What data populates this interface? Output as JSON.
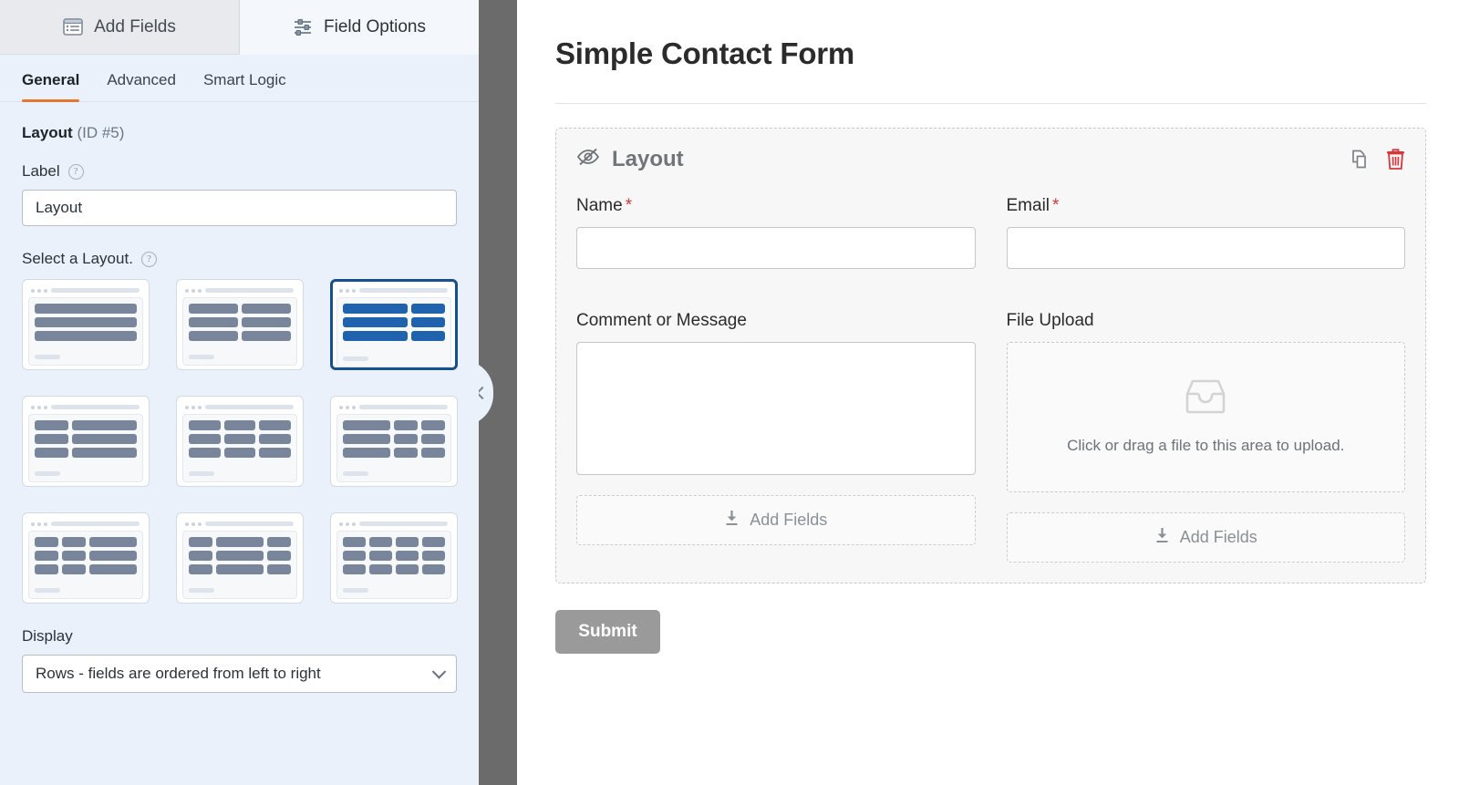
{
  "panel": {
    "tabs": [
      {
        "label": "Add Fields",
        "icon": "form-list-icon",
        "active": false
      },
      {
        "label": "Field Options",
        "icon": "sliders-icon",
        "active": true
      }
    ],
    "subtabs": [
      {
        "label": "General",
        "active": true
      },
      {
        "label": "Advanced",
        "active": false
      },
      {
        "label": "Smart Logic",
        "active": false
      }
    ],
    "field_heading": {
      "name": "Layout",
      "id": "(ID #5)"
    },
    "label_setting": {
      "label": "Label",
      "help_icon": "help-circle-icon",
      "value": "Layout"
    },
    "layout_setting": {
      "label": "Select a Layout.",
      "help_icon": "help-circle-icon",
      "presets": [
        {
          "name": "one-column",
          "selected": false,
          "rows": [
            [
              100
            ],
            [
              100
            ],
            [
              100
            ]
          ]
        },
        {
          "name": "two-column-equal",
          "selected": false,
          "rows": [
            [
              50,
              50
            ],
            [
              50,
              50
            ],
            [
              50,
              50
            ]
          ]
        },
        {
          "name": "two-column-wide-narrow",
          "selected": true,
          "rows": [
            [
              66,
              34
            ],
            [
              66,
              34
            ],
            [
              66,
              34
            ]
          ]
        },
        {
          "name": "two-column-narrow-wide",
          "selected": false,
          "rows": [
            [
              34,
              66
            ],
            [
              34,
              66
            ],
            [
              34,
              66
            ]
          ]
        },
        {
          "name": "three-column-equal",
          "selected": false,
          "rows": [
            [
              33,
              33,
              33
            ],
            [
              33,
              33,
              33
            ],
            [
              33,
              33,
              33
            ]
          ]
        },
        {
          "name": "three-column-wide-narrow-narrow",
          "selected": false,
          "rows": [
            [
              50,
              25,
              25
            ],
            [
              50,
              25,
              25
            ],
            [
              50,
              25,
              25
            ]
          ]
        },
        {
          "name": "three-column-narrow-narrow-wide",
          "selected": false,
          "rows": [
            [
              25,
              25,
              50
            ],
            [
              25,
              25,
              50
            ],
            [
              25,
              25,
              50
            ]
          ]
        },
        {
          "name": "three-column-narrow-wide-narrow",
          "selected": false,
          "rows": [
            [
              25,
              50,
              25
            ],
            [
              25,
              50,
              25
            ],
            [
              25,
              50,
              25
            ]
          ]
        },
        {
          "name": "four-column-equal",
          "selected": false,
          "rows": [
            [
              25,
              25,
              25,
              25
            ],
            [
              25,
              25,
              25,
              25
            ],
            [
              25,
              25,
              25,
              25
            ]
          ]
        }
      ]
    },
    "display_setting": {
      "label": "Display",
      "value": "Rows - fields are ordered from left to right",
      "chevron_icon": "chevron-down-icon"
    },
    "collapse_handle_icon": "chevron-left-icon"
  },
  "preview": {
    "form_title": "Simple Contact Form",
    "layout_block": {
      "title": "Layout",
      "hidden_icon": "eye-slash-icon",
      "duplicate_icon": "duplicate-icon",
      "delete_icon": "trash-icon",
      "left_column": {
        "name_field": {
          "label": "Name",
          "required": "*"
        },
        "message_field": {
          "label": "Comment or Message",
          "required": ""
        },
        "add_fields": {
          "label": "Add Fields",
          "icon": "insert-down-icon"
        }
      },
      "right_column": {
        "email_field": {
          "label": "Email",
          "required": "*"
        },
        "upload_field": {
          "label": "File Upload",
          "icon": "inbox-tray-icon",
          "dropzone_text": "Click or drag a file to this area to upload."
        },
        "add_fields": {
          "label": "Add Fields",
          "icon": "insert-down-icon"
        }
      }
    },
    "submit_label": "Submit"
  },
  "colors": {
    "accent_orange": "#e27730",
    "selected_blue": "#1f63ae",
    "selected_border": "#17508f",
    "danger_red": "#d63638",
    "sidebar_bg": "#eaf1fb",
    "divider_gray": "#6b6b6b",
    "submit_gray": "#9a9a9a"
  }
}
